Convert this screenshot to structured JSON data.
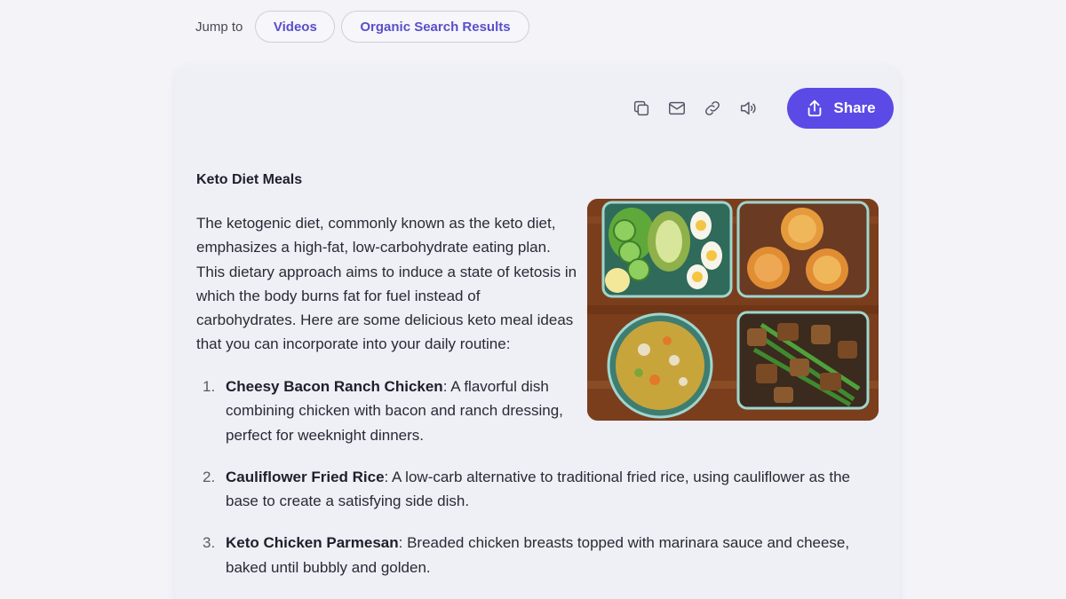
{
  "jump_bar": {
    "label": "Jump to",
    "links": [
      "Videos",
      "Organic Search Results"
    ]
  },
  "toolbar": {
    "icons": [
      "copy-icon",
      "mail-icon",
      "link-icon",
      "speaker-icon"
    ],
    "share_label": "Share"
  },
  "answer": {
    "heading": "Keto Diet Meals",
    "intro": "The ketogenic diet, commonly known as the keto diet, emphasizes a high-fat, low-carbohydrate eating plan. This dietary approach aims to induce a state of ketosis in which the body burns fat for fuel instead of carbohydrates. Here are some delicious keto meal ideas that you can incorporate into your daily routine:",
    "items": [
      {
        "num": "1.",
        "title": "Cheesy Bacon Ranch Chicken",
        "text": ": A flavorful dish combining chicken with bacon and ranch dressing, perfect for weeknight dinners."
      },
      {
        "num": "2.",
        "title": "Cauliflower Fried Rice",
        "text": ": A low-carb alternative to traditional fried rice, using cauliflower as the base to create a satisfying side dish."
      },
      {
        "num": "3.",
        "title": "Keto Chicken Parmesan",
        "text": ": Breaded chicken breasts topped with marinara sauce and cheese, baked until bubbly and golden."
      }
    ]
  },
  "colors": {
    "accent": "#5b4ae6",
    "pill_text": "#5a4fc8",
    "background": "#f3f3f8",
    "card": "#efeff6"
  }
}
